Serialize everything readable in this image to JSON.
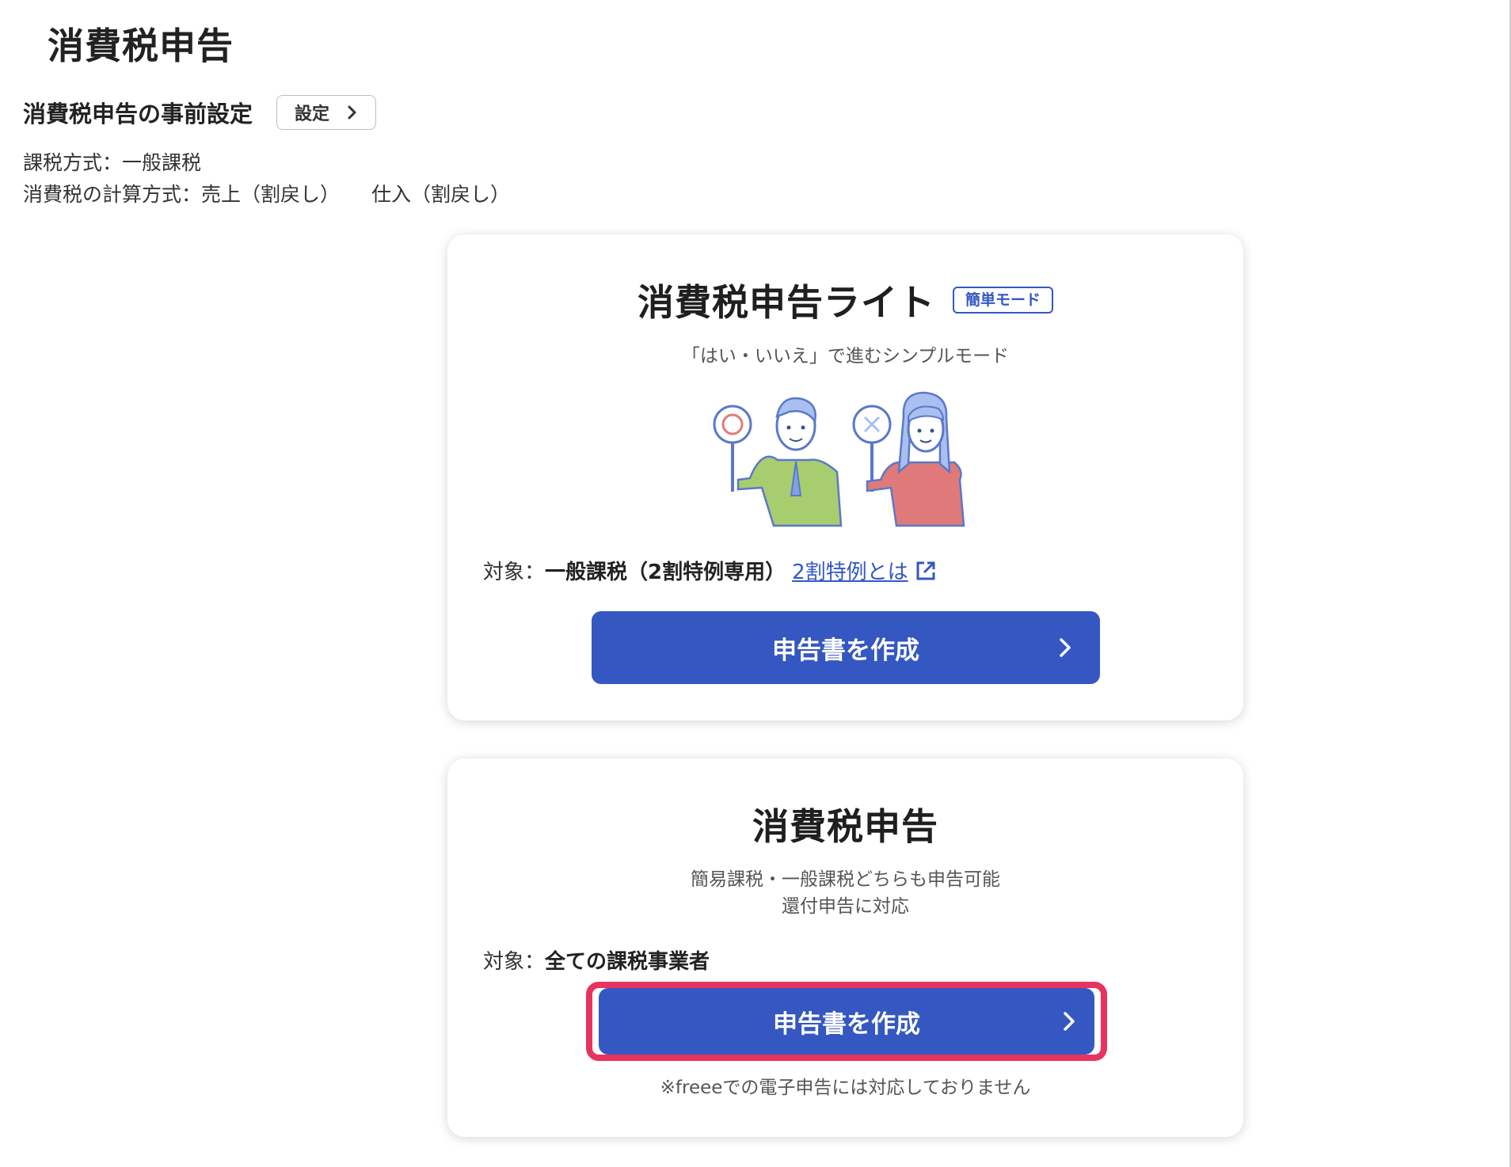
{
  "page": {
    "title": "消費税申告"
  },
  "pre_settings": {
    "title": "消費税申告の事前設定",
    "button_label": "設定",
    "tax_method": "課税方式：一般課税",
    "calc_sales": "消費税の計算方式：売上（割戻し）",
    "calc_purchase": "仕入（割戻し）"
  },
  "lite_card": {
    "title": "消費税申告ライト",
    "badge": "簡単モード",
    "subtitle": "「はい・いいえ」で進むシンプルモード",
    "target_label": "対象：",
    "target_value": "一般課税（2割特例専用）",
    "link_text": "2割特例とは",
    "button_label": "申告書を作成"
  },
  "standard_card": {
    "title": "消費税申告",
    "subtitle_line1": "簡易課税・一般課税どちらも申告可能",
    "subtitle_line2": "還付申告に対応",
    "target_label": "対象：",
    "target_value": "全ての課税事業者",
    "button_label": "申告書を作成",
    "note": "※freeeでの電子申告には対応しておりません"
  },
  "colors": {
    "primary": "#3557c1",
    "highlight": "#e8325f",
    "link": "#3358c4"
  }
}
